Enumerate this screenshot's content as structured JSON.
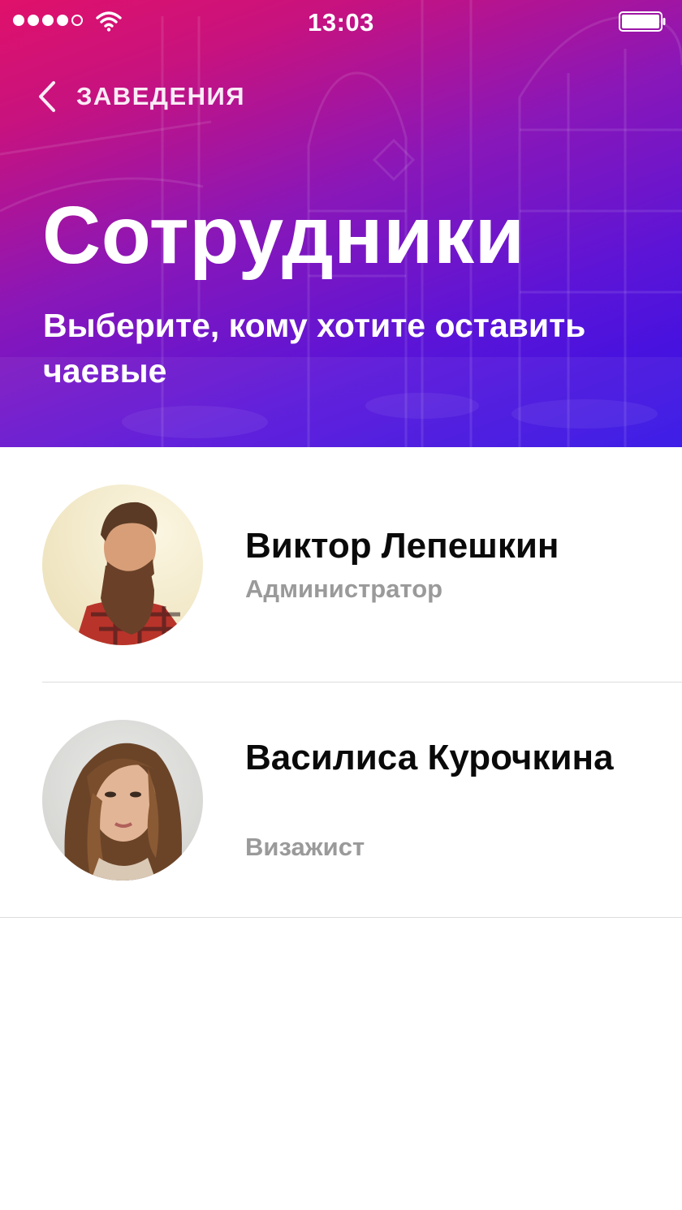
{
  "status_bar": {
    "time": "13:03",
    "signal_bars_filled": 4,
    "signal_bars_total": 5,
    "signal_icon": "cellular-signal-icon",
    "wifi_icon": "wifi-icon",
    "battery_icon": "battery-icon"
  },
  "nav": {
    "back_label": "ЗАВЕДЕНИЯ",
    "back_icon": "chevron-left-icon"
  },
  "header": {
    "title": "Сотрудники",
    "subtitle": "Выберите, кому хотите оставить чаевые"
  },
  "staff": [
    {
      "name": "Виктор Лепешкин",
      "role": "Администратор",
      "avatar": "avatar-photo"
    },
    {
      "name": "Василиса Курочкина",
      "role": "Визажист",
      "avatar": "avatar-photo"
    }
  ],
  "colors": {
    "gradient_start": "#e0116a",
    "gradient_end": "#3210e6",
    "name_text": "#0a0a0a",
    "role_text": "#9a9a9a",
    "divider": "#dddddd"
  }
}
